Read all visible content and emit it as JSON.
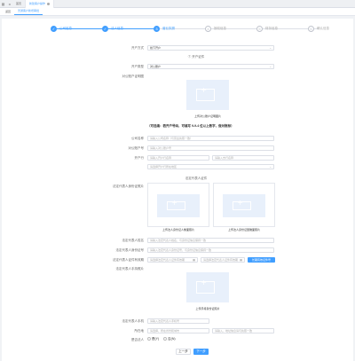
{
  "topbar": {
    "home_tab": "首页",
    "active_tab": "新建客户操作",
    "icons": [
      "app-icon",
      "back-icon"
    ]
  },
  "subbar": {
    "tabs": [
      "返回",
      "普通客户新增审批"
    ]
  },
  "steps": [
    {
      "num": "✓",
      "label": "公司信息"
    },
    {
      "num": "✓",
      "label": "法人信息"
    },
    {
      "num": "3",
      "label": "营业执照"
    },
    {
      "num": "4",
      "label": "授权信息"
    },
    {
      "num": "5",
      "label": "财务信息"
    },
    {
      "num": "6",
      "label": "确认信息"
    }
  ],
  "form": {
    "open_method_label": "开户方式",
    "open_method_value": "线下开户",
    "open_method_title": "① 开户证件",
    "account_type_label": "开户类型",
    "account_type_value": "对公账户",
    "license_label": "对公账户证明图",
    "license_upload": "上传对公账户证明图片",
    "note": "（可选填：若开户号码，可填写 9-9-4 位以上数字，做对账标）",
    "company_name_label": "公司名称",
    "company_name_ph": "请输入公司名称（与营业执照一致）",
    "bank_account_label": "对公账户号",
    "bank_account_ph": "请输入对公账户号",
    "bank_label": "开户行",
    "bank_ph1": "请输入开户行名称",
    "bank_ph2": "请输入支行名称",
    "bank_select_ph": "请选择开户行所在地区",
    "legal_title": "法定代表人证件",
    "legal_id_label": "法定代表人身份证照片",
    "legal_front_upload": "上传法人身份证人像面照片",
    "legal_back_upload": "上传法人身份证国徽面照片",
    "legal_name_label": "法定代表人姓名",
    "legal_name_ph": "请输入法定代表人姓名，与身份证信息保持一致",
    "legal_idno_label": "法定代表人身份证号",
    "legal_idno_ph": "请输入法定代表人身份证号，与身份证信息保持一致",
    "legal_valid_label": "法定代表人证件有效期",
    "legal_valid_ph1": "请选择法定代表人证件有效期",
    "legal_valid_ph2": "请选择法定代表人证件有效期",
    "legal_valid_btn": "长期有效证件号",
    "legal_hand_label": "法定代表人手持照片",
    "legal_hand_upload": "上传手持身份证照片",
    "legal_phone_label": "法定代表人手机",
    "legal_phone_ph": "请输入法定代表人手机号",
    "region_label": "所在地",
    "region_ph1": "请选择，所在省份和城市",
    "region_ph2": "请输入，地址信息请与执照一致",
    "is_legal_label": "是否法人",
    "radio_yes": "是(Y)",
    "radio_no": "否(N)",
    "prev_btn": "上一步",
    "next_btn": "下一步"
  },
  "colors": {
    "accent": "#409eff",
    "placeholder_bg": "#e8f0fb"
  }
}
